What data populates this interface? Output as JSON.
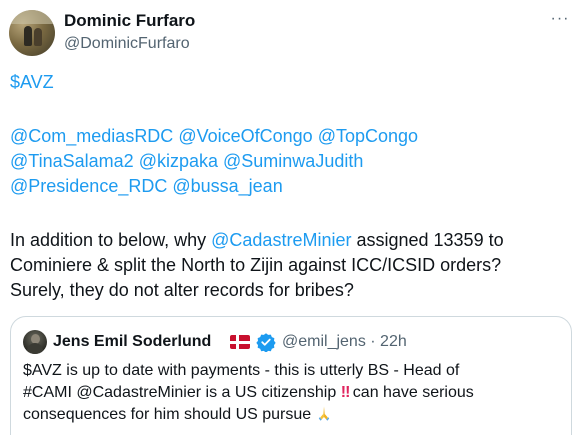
{
  "author": {
    "name": "Dominic Furfaro",
    "handle": "@DominicFurfaro"
  },
  "menu_label": "···",
  "tweet": {
    "cashtag": "$AVZ",
    "mentions_line1": [
      "@Com_mediasRDC",
      "@VoiceOfCongo",
      "@TopCongo"
    ],
    "mentions_line2": [
      "@TinaSalama2",
      "@kizpaka",
      "@SuminwaJudith"
    ],
    "mentions_line3": [
      "@Presidence_RDC",
      "@bussa_jean"
    ],
    "body_line1_pre": "In addition to below, why ",
    "body_line1_mention": "@CadastreMinier",
    "body_line1_post": " assigned 13359 to",
    "body_line2": "Cominiere & split the North to Zijin against ICC/ICSID orders?",
    "body_line3": "Surely, they do not alter records for bribes?"
  },
  "quote": {
    "name": "Jens Emil Soderlund",
    "handle_time": "@emil_jens · 22h",
    "line1": "$AVZ is up to date with payments - this is utterly BS - Head of",
    "line2_pre": "#CAMI @CadastreMinier is a US citizenship ",
    "line2_emoji": "‼",
    "line2_post": " can have serious",
    "line3": "consequences for him should US pursue "
  },
  "colors": {
    "link": "#1d9bf0",
    "text": "#0f1419",
    "secondary": "#536471",
    "border": "#cfd9de"
  },
  "icons": [
    "more-icon",
    "danish-flag-icon",
    "verified-badge-icon",
    "double-exclamation-icon",
    "folded-hands-icon"
  ]
}
